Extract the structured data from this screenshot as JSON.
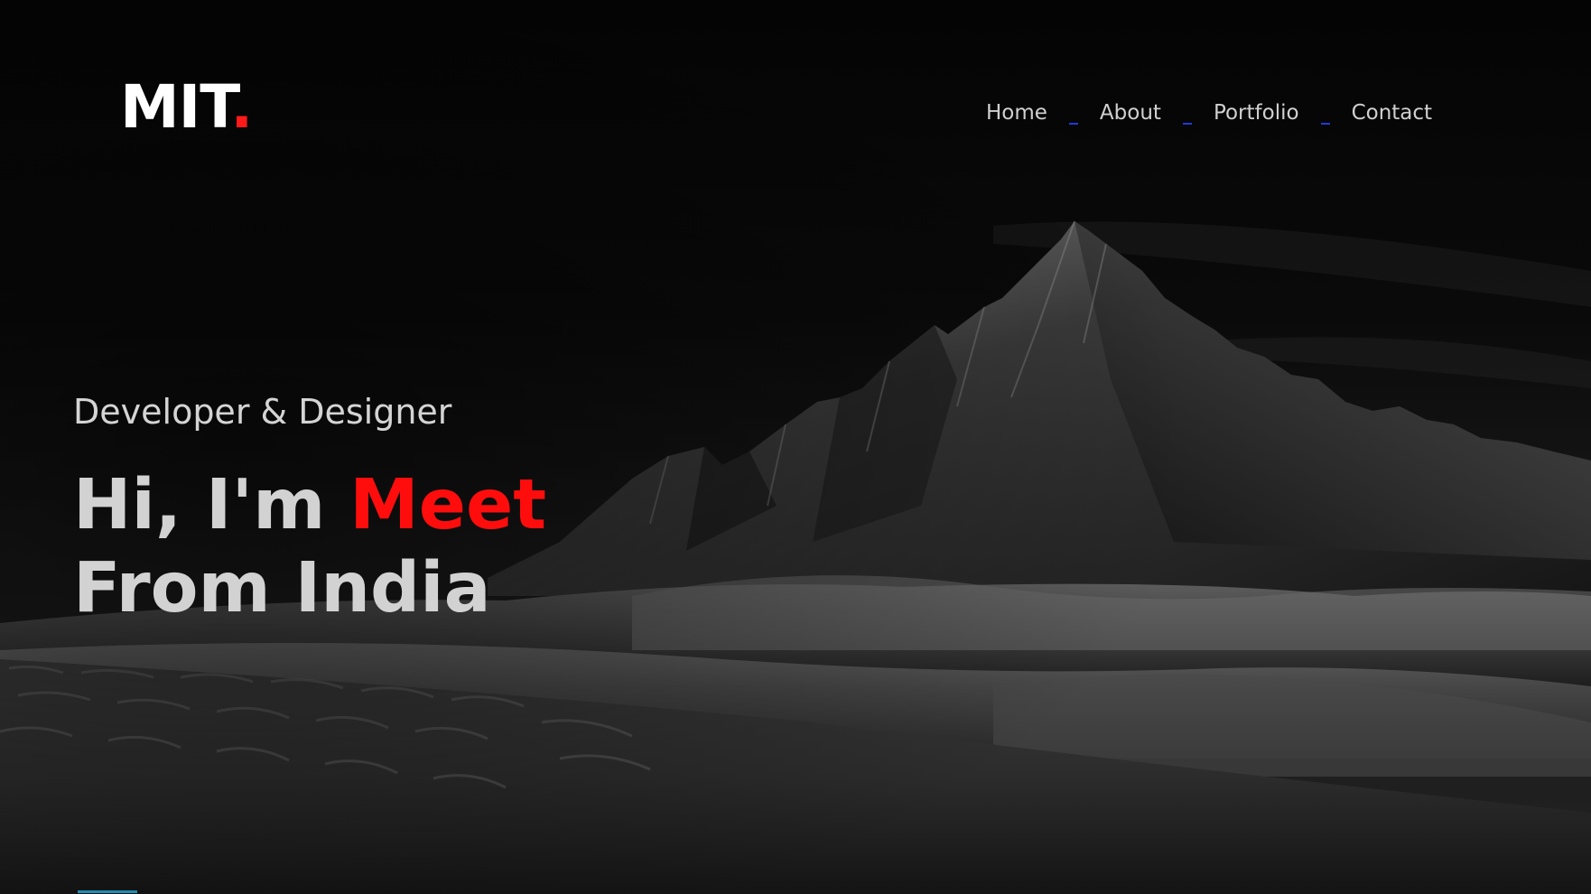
{
  "logo": {
    "text": "MIT",
    "dot": "."
  },
  "nav": {
    "items": [
      {
        "label": "Home"
      },
      {
        "label": "About"
      },
      {
        "label": "Portfolio"
      },
      {
        "label": "Contact"
      }
    ]
  },
  "hero": {
    "subtitle": "Developer & Designer",
    "line1_prefix": "Hi, I'm ",
    "line1_name": "Meet",
    "line2": "From India"
  },
  "colors": {
    "accent": "#ff0d0d",
    "background": "#070707",
    "text": "#d2d2d2",
    "nav_separator": "#1f3bd8"
  }
}
